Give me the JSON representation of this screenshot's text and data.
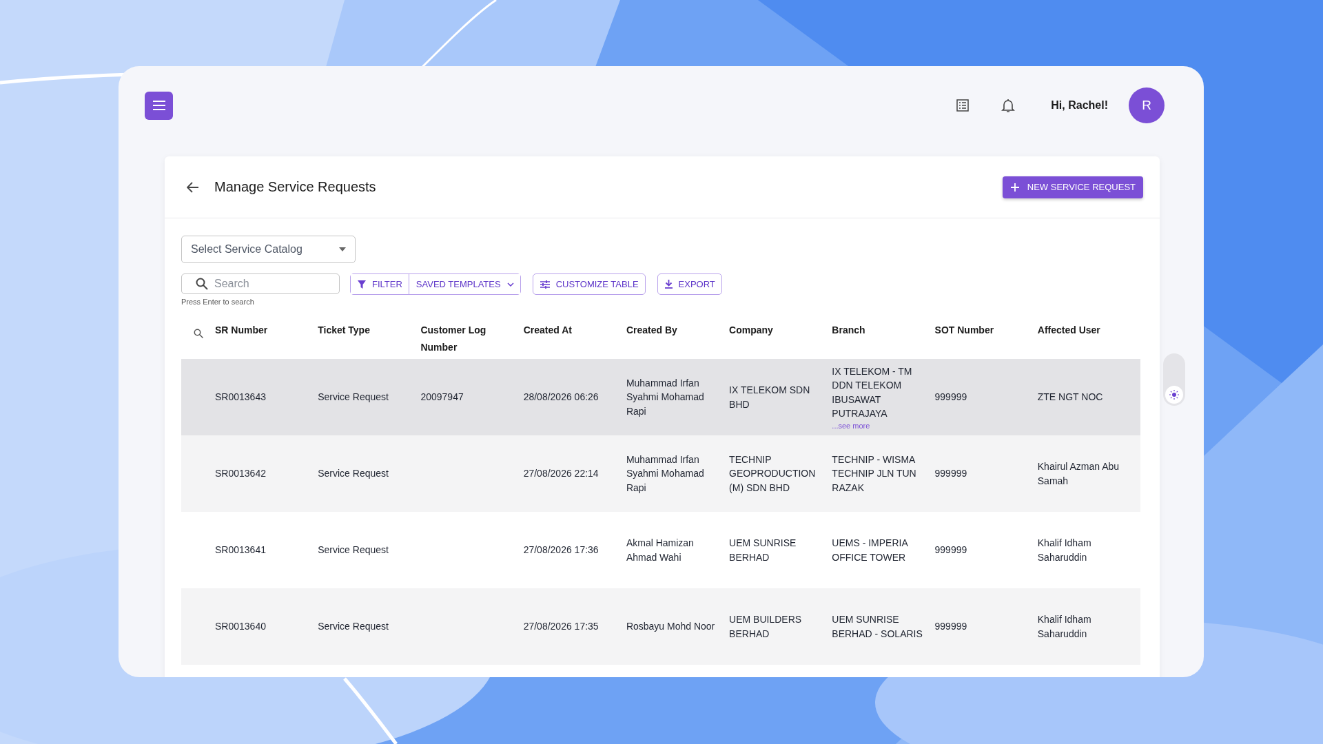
{
  "header": {
    "greeting": "Hi, Rachel!",
    "avatar_initial": "R"
  },
  "page": {
    "title": "Manage Service Requests",
    "new_button": "NEW SERVICE REQUEST"
  },
  "catalog_select": {
    "placeholder": "Select Service Catalog"
  },
  "search": {
    "placeholder": "Search",
    "hint": "Press Enter to search"
  },
  "toolbar": {
    "filter": "FILTER",
    "saved_templates": "SAVED TEMPLATES",
    "customize": "CUSTOMIZE TABLE",
    "export": "EXPORT"
  },
  "table": {
    "columns": [
      "SR Number",
      "Ticket Type",
      "Customer Log Number",
      "Created At",
      "Created By",
      "Company",
      "Branch",
      "SOT Number",
      "Affected User"
    ],
    "rows": [
      {
        "selected": true,
        "cells": [
          "SR0013643",
          "Service Request",
          "20097947",
          "28/08/2026 06:26",
          "Muhammad Irfan Syahmi Mohamad Rapi",
          "IX TELEKOM SDN BHD",
          "IX TELEKOM - TM DDN TELEKOM IBUSAWAT PUTRAJAYA",
          "999999",
          "ZTE NGT NOC"
        ],
        "see_more": "...see more"
      },
      {
        "selected": false,
        "cells": [
          "SR0013642",
          "Service Request",
          null,
          "27/08/2026 22:14",
          "Muhammad Irfan Syahmi Mohamad Rapi",
          "TECHNIP GEOPRODUCTION (M) SDN BHD",
          "TECHNIP - WISMA TECHNIP JLN TUN RAZAK",
          "999999",
          "Khairul Azman Abu Samah"
        ]
      },
      {
        "selected": false,
        "cells": [
          "SR0013641",
          "Service Request",
          null,
          "27/08/2026 17:36",
          "Akmal Hamizan Ahmad Wahi",
          "UEM SUNRISE BERHAD",
          "UEMS - IMPERIA OFFICE TOWER",
          "999999",
          "Khalif Idham Saharuddin"
        ]
      },
      {
        "selected": false,
        "cells": [
          "SR0013640",
          "Service Request",
          null,
          "27/08/2026 17:35",
          "Rosbayu Mohd Noor",
          "UEM BUILDERS BERHAD",
          "UEM SUNRISE BERHAD - SOLARIS",
          "999999",
          "Khalif Idham Saharuddin"
        ]
      }
    ]
  },
  "theme_toggle": {
    "on": false
  }
}
